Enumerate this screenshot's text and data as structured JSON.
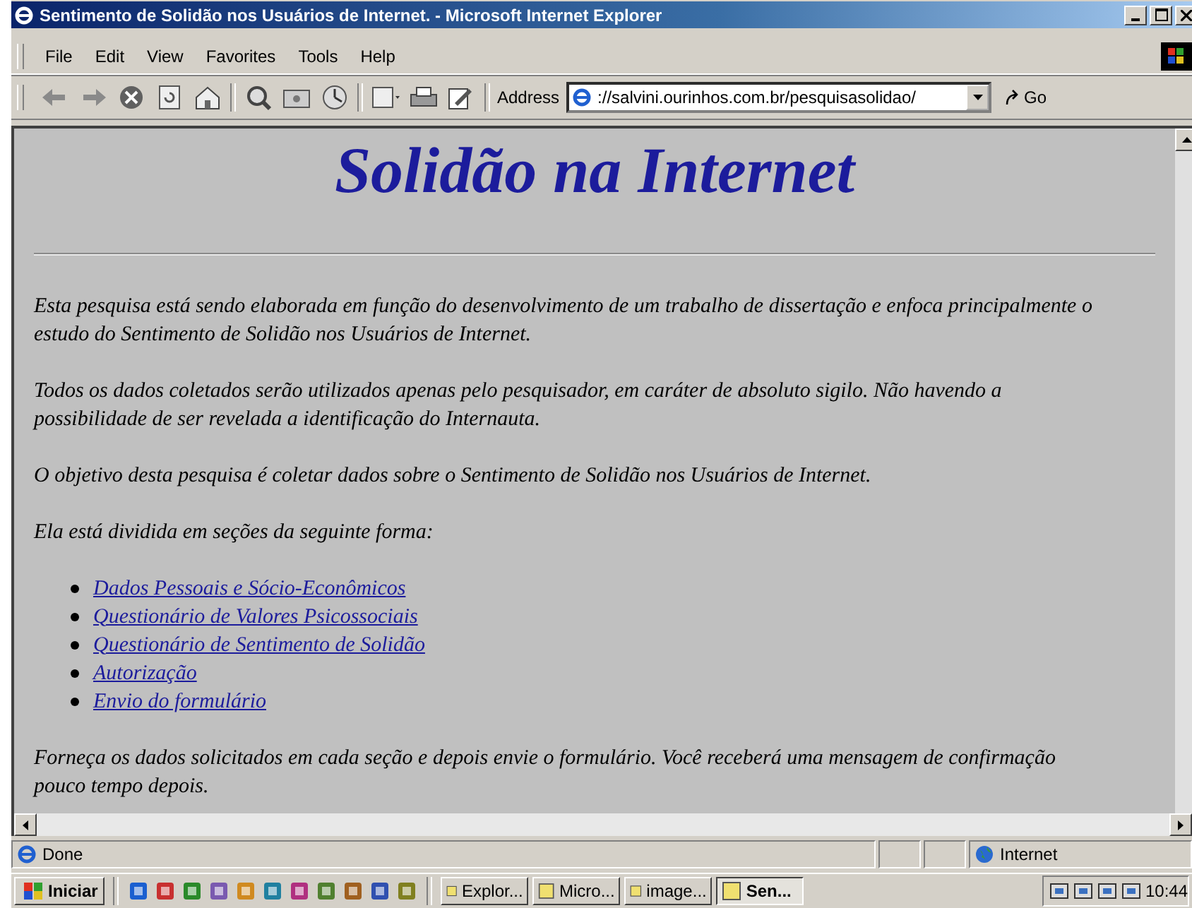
{
  "window": {
    "title": "Sentimento de Solidão nos Usuários de Internet. - Microsoft Internet Explorer"
  },
  "menu": [
    "File",
    "Edit",
    "View",
    "Favorites",
    "Tools",
    "Help"
  ],
  "address": {
    "label": "Address",
    "value": "://salvini.ourinhos.com.br/pesquisasolidao/",
    "go": "Go"
  },
  "page": {
    "heading": "Solidão na Internet",
    "paragraphs_top": [
      "Esta pesquisa está sendo elaborada em função do desenvolvimento de um trabalho de dissertação e enfoca principalmente o estudo do Sentimento de Solidão nos Usuários de Internet.",
      "Todos os dados coletados serão utilizados apenas pelo pesquisador, em caráter de absoluto sigilo. Não havendo a possibilidade de ser revelada a identificação do Internauta.",
      "O objetivo desta pesquisa é coletar dados sobre o Sentimento de Solidão nos Usuários de Internet.",
      "Ela está dividida em seções da seguinte forma:"
    ],
    "links": [
      "Dados Pessoais e Sócio-Econômicos",
      "Questionário de Valores Psicossociais",
      "Questionário de Sentimento de Solidão",
      "Autorização",
      "Envio do formulário"
    ],
    "paragraphs_bottom": [
      "Forneça os dados solicitados em cada seção e depois envie o formulário. Você receberá uma mensagem de confirmação pouco tempo depois."
    ]
  },
  "status_bar": {
    "text": "Done",
    "zone": "Internet"
  },
  "taskbar": {
    "start": "Iniciar",
    "tasks": [
      {
        "label": "Explor...",
        "selected": false
      },
      {
        "label": "Micro...",
        "selected": false
      },
      {
        "label": "image...",
        "selected": false
      },
      {
        "label": "Sen...",
        "selected": true
      }
    ],
    "clock": "10:44"
  }
}
